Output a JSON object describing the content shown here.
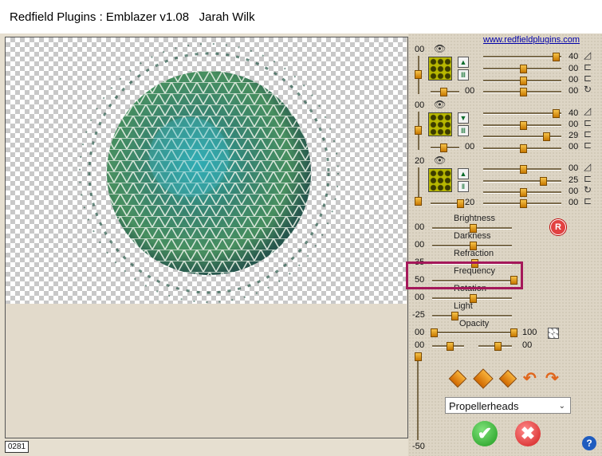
{
  "window": {
    "title": "Redfield Plugins : Emblazer v1.08   Jarah Wilk"
  },
  "link": {
    "text": "www.redfieldplugins.com"
  },
  "preview": {
    "zoom": "0281"
  },
  "layer1": {
    "top": "00",
    "v1": "40",
    "v2": "00",
    "v3": "00",
    "v4": "00",
    "bottom": "00"
  },
  "layer2": {
    "top": "00",
    "v1": "40",
    "v2": "00",
    "v3": "29",
    "v4": "00",
    "bottom": "00"
  },
  "layer3": {
    "top": "20",
    "v1": "00",
    "v2": "25",
    "v3": "00",
    "v4": "00",
    "bottom": "20"
  },
  "params": [
    {
      "label": "Brightness",
      "value": "00"
    },
    {
      "label": "Darkness",
      "value": "00"
    },
    {
      "label": "Refraction",
      "value": "35"
    },
    {
      "label": "Frequency",
      "value": "50"
    },
    {
      "label": "Rotation",
      "value": "00"
    },
    {
      "label": "Light",
      "value": "-25"
    },
    {
      "label": "Opacity",
      "value": "00",
      "max": "100"
    }
  ],
  "extra": {
    "left": "00",
    "right": "00"
  },
  "vertical": {
    "top": "00",
    "bottom": "-50"
  },
  "preset": {
    "selected": "Propellerheads"
  },
  "badge": {
    "text": "R"
  },
  "buttons": {
    "ok": "✔",
    "cancel": "✖",
    "help": "?"
  },
  "icons": {
    "eye": "eye-icon",
    "ok": "checkmark-icon",
    "cancel": "close-icon",
    "help": "help-icon"
  },
  "colors": {
    "accent": "#f0a020",
    "highlight": "#a4185a"
  }
}
